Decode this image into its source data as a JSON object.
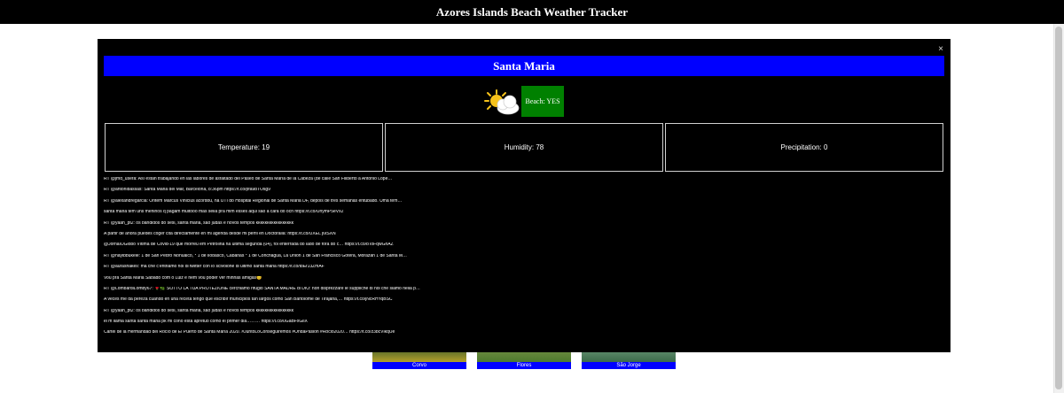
{
  "header": {
    "title": "Azores Islands Beach Weather Tracker"
  },
  "thumbnails": [
    {
      "label": "Corvo",
      "color": "#b3a02a"
    },
    {
      "label": "Flores",
      "color": "#4d7a2e"
    },
    {
      "label": "São Jorge",
      "color": "#3c6b4a"
    }
  ],
  "modal": {
    "close_label": "×",
    "island": "Santa Maria",
    "weather_icon": "partly-cloudy-icon",
    "beach_status": "Beach: YES",
    "colors": {
      "banner": "#0000ff",
      "beach_yes": "#008000"
    },
    "stats": [
      {
        "name": "stat-temperature",
        "text": "Temperature: 19"
      },
      {
        "name": "stat-humidity",
        "text": "Humidity: 78"
      },
      {
        "name": "stat-precipitation",
        "text": "Precipitation: 0"
      }
    ],
    "tweets": [
      "RT @jmd_usera: Así están trabajando en las labores de asfaltado del Paseo de Santa María de la Cabeza (de calle San Filiberto a Antonio Lópe…",
      "RT @antonibassas: Santa Maria del Mar, Barcelona, 8:36pm https://t.co/pfa9bTOsg9",
      "RT @alexandregarcia: Ontem Marcus Vinicius acordou, na UTI do Hospital Regional de Santa Maria DF, depois de três semanas entubado. Uma tem…",
      "santa maria tem uns meninos q pagam muitooo mas sella pra mim esses aqui são a cara do och https://t.co/UnymP5eVx2",
      "RT @yaah_pt2: os bandidos do sesi, santa maria, são judas e novos tempos kkkkkkkkkkkkkkkkk",
      "A partir de ahora puedes coger cita directamente en mi agenda desde mi perfil en Doctoralia: https://t.co/UXEL j6tSXN",
      "@JornalOGlobo Vítima de Covid-19 que morreu em Petrolina na última segunda (04), foi enterrada do lado de fora do c… https://t.co/bToFqwGnAZ",
      "RT @nayibbukele: 1 de San Pedro Nonualco, * 1 de Ilobasco, Cabañas * 1 de Conchagua, La Unión 1 de San Francisco Gotera, Morazán 1 de Santa M…",
      "RT @aurashakes: ma che c'entriamo noi di twitter con lo scivolone di ultimo santa maria https://t.co/t8ErJ3ZmAF",
      "Vou pra Santa Maria Sábado com o Luiz e nem vou poder ver minhas amigas😔",
      "RT @LombardiLomby67: 🌹🌿 SOTTO LA TUA PROTEZIONE cerchiamo rifugio SANTA MADRE di DIO: non disprezzare le suppliche di noi che siamo nella p…",
      "A veces me da pereza cuando en una receta tengo que escribir municipios tan largos como San Bartolomé de Tirajana,… https://t.co/jNcRHYqBSC",
      "RT @yaah_pt2: os bandidos do sesi, santa maria, são judas e novos tempos kkkkkkkkkkkkkkkkk",
      "el m llama santa santa maria pk mi coño está apretuo como el primer dia……… https://t.co/0GaBFxGliX",
      "Cartel de la Hermandad del Rocío de El Puerto de Santa María 2020. #JuntoLoConseguiremos #OndaPasion #Rocio2020… https://t.co/z3bcVlkqUe"
    ]
  }
}
